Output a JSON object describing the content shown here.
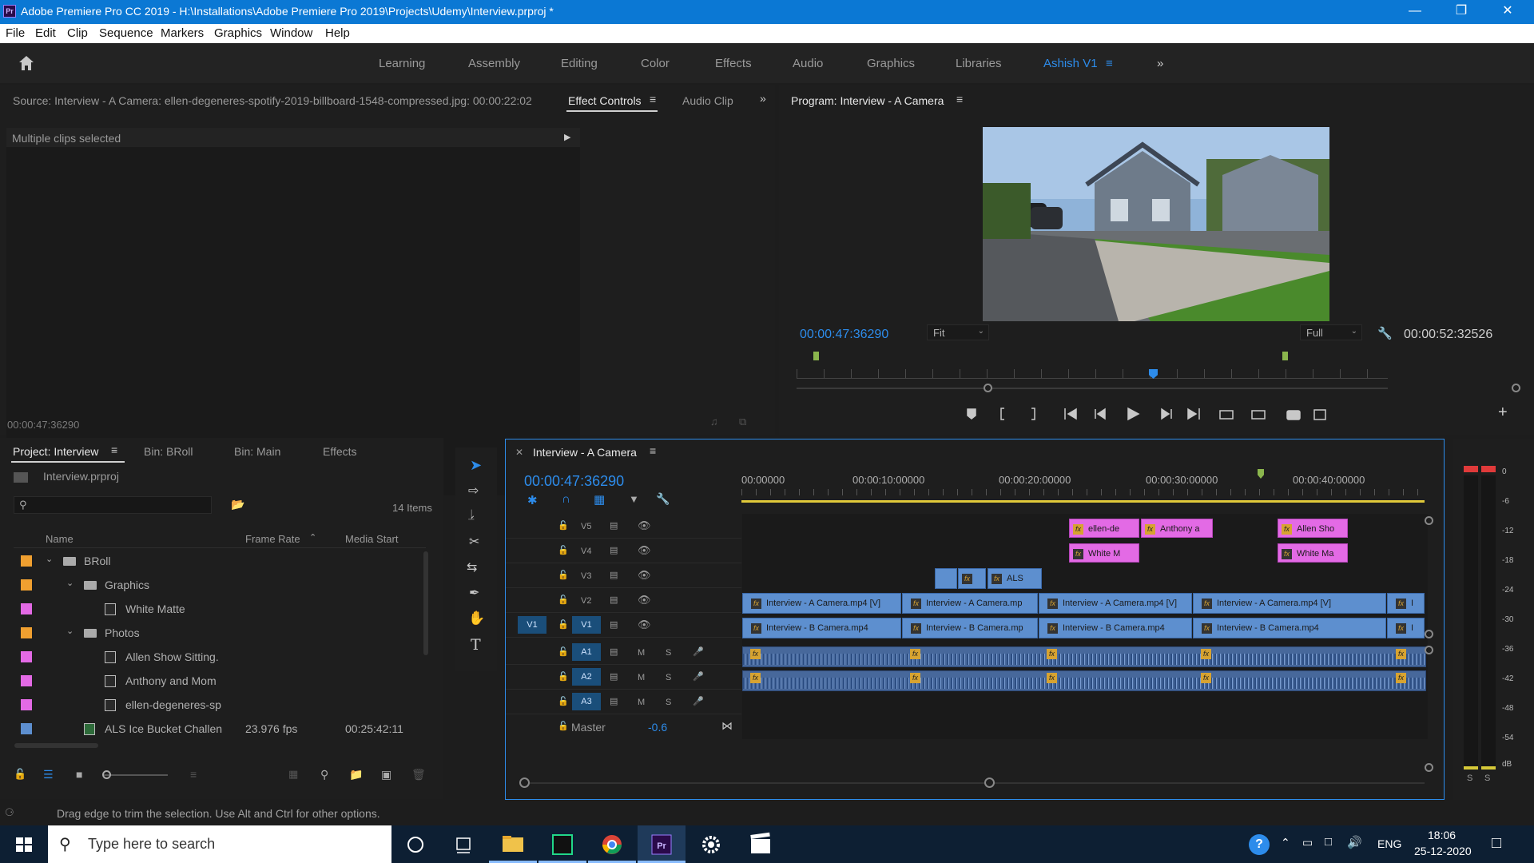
{
  "window": {
    "title": "Adobe Premiere Pro CC 2019 - H:\\Installations\\Adobe Premiere Pro 2019\\Projects\\Udemy\\Interview.prproj *",
    "app_badge": "Pr"
  },
  "menu": [
    "File",
    "Edit",
    "Clip",
    "Sequence",
    "Markers",
    "Graphics",
    "Window",
    "Help"
  ],
  "workspaces": {
    "items": [
      "Learning",
      "Assembly",
      "Editing",
      "Color",
      "Effects",
      "Audio",
      "Graphics",
      "Libraries",
      "Ashish V1"
    ],
    "active": "Ashish V1"
  },
  "source_panel": {
    "title": "Source: Interview - A Camera: ellen-degeneres-spotify-2019-billboard-1548-compressed.jpg: 00:00:22:02",
    "tabs": [
      "Effect Controls",
      "Audio Clip"
    ],
    "message": "Multiple clips selected",
    "timecode": "00:00:47:36290"
  },
  "program_monitor": {
    "title": "Program: Interview - A Camera",
    "timecode": "00:00:47:36290",
    "fit": "Fit",
    "resolution": "Full",
    "duration": "00:00:52:32526"
  },
  "project_panel": {
    "tabs": [
      "Project: Interview",
      "Bin: BRoll",
      "Bin: Main",
      "Effects"
    ],
    "project_file": "Interview.prproj",
    "item_count": "14 Items",
    "columns": [
      "Name",
      "Frame Rate",
      "Media Start"
    ],
    "rows": [
      {
        "name": "BRoll",
        "type": "bin",
        "indent": 0,
        "color": "#f0a030",
        "rate": "",
        "start": ""
      },
      {
        "name": "Graphics",
        "type": "bin",
        "indent": 1,
        "color": "#f0a030",
        "rate": "",
        "start": ""
      },
      {
        "name": "White Matte",
        "type": "still",
        "indent": 2,
        "color": "#e36ae5",
        "rate": "",
        "start": ""
      },
      {
        "name": "Photos",
        "type": "bin",
        "indent": 1,
        "color": "#f0a030",
        "rate": "",
        "start": ""
      },
      {
        "name": "Allen Show Sitting.",
        "type": "still",
        "indent": 2,
        "color": "#e36ae5",
        "rate": "",
        "start": ""
      },
      {
        "name": "Anthony and Mom",
        "type": "still",
        "indent": 2,
        "color": "#e36ae5",
        "rate": "",
        "start": ""
      },
      {
        "name": "ellen-degeneres-sp",
        "type": "still",
        "indent": 2,
        "color": "#e36ae5",
        "rate": "",
        "start": ""
      },
      {
        "name": "ALS Ice Bucket Challen",
        "type": "video",
        "indent": 1,
        "color": "#5d8fcf",
        "rate": "23.976 fps",
        "start": "00:25:42:11"
      }
    ]
  },
  "timeline": {
    "sequence": "Interview - A Camera",
    "timecode": "00:00:47:36290",
    "ruler": [
      "00:00000",
      "00:00:10:00000",
      "00:00:20:00000",
      "00:00:30:00000",
      "00:00:40:00000"
    ],
    "video_tracks": [
      "V5",
      "V4",
      "V3",
      "V2",
      "V1"
    ],
    "audio_tracks": [
      "A1",
      "A2",
      "A3"
    ],
    "source_patch": "V1",
    "master_label": "Master",
    "master_value": "-0.6",
    "mute_label": "M",
    "solo_label": "S",
    "clips": {
      "v5": [
        "ellen-de",
        "Anthony a",
        "Allen Sho"
      ],
      "v4": [
        "White M",
        "White Ma"
      ],
      "v3": [
        "ALS"
      ],
      "v2": [
        "Interview - A Camera.mp4 [V]",
        "Interview - A Camera.mp",
        "Interview - A Camera.mp4 [V]",
        "Interview - A Camera.mp4 [V]",
        "I"
      ],
      "v1": [
        "Interview - B Camera.mp4",
        "Interview - B Camera.mp",
        "Interview - B Camera.mp4",
        "Interview - B Camera.mp4",
        "I"
      ]
    }
  },
  "audio_meter": {
    "scale": [
      "0",
      "-6",
      "-12",
      "-18",
      "-24",
      "-30",
      "-36",
      "-42",
      "-48",
      "-54",
      "dB"
    ],
    "solo_buttons": [
      "S",
      "S"
    ]
  },
  "status_bar": "Drag edge to trim the selection. Use Alt and Ctrl for other options.",
  "taskbar": {
    "search_placeholder": "Type here to search",
    "language": "ENG",
    "time": "18:06",
    "date": "25-12-2020"
  }
}
